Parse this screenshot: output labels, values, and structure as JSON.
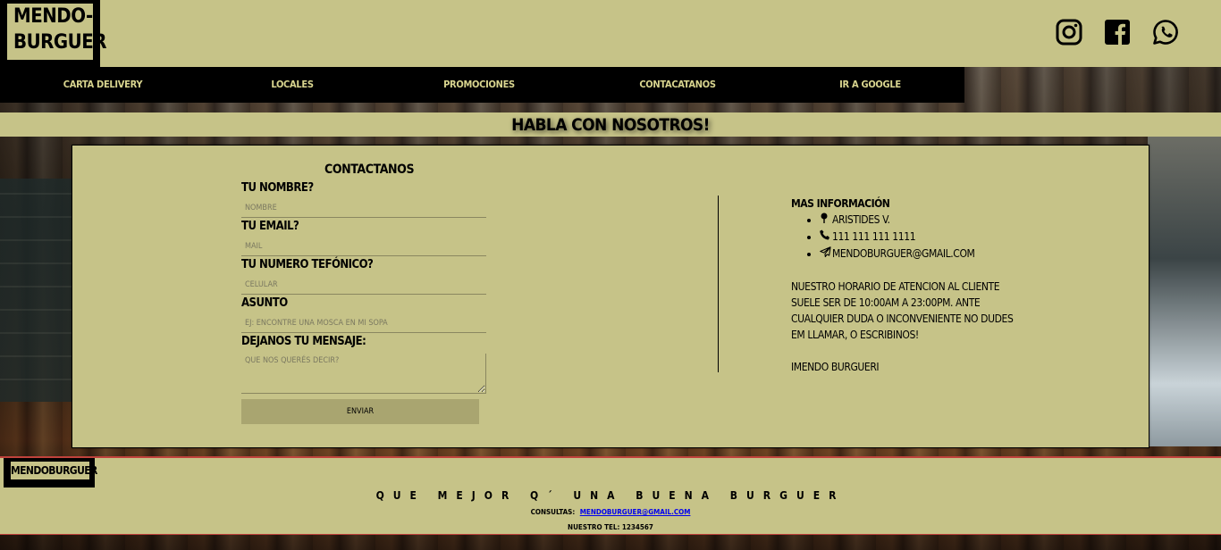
{
  "header": {
    "logo_line1": "MENDO-",
    "logo_line2": "BURGUER",
    "social": [
      {
        "icon": "instagram-icon"
      },
      {
        "icon": "facebook-icon"
      },
      {
        "icon": "whatsapp-icon"
      }
    ]
  },
  "nav": {
    "items": [
      {
        "label": "CARTA DELIVERY"
      },
      {
        "label": "LOCALES"
      },
      {
        "label": "PROMOCIONES"
      },
      {
        "label": "CONTACATANOS"
      },
      {
        "label": "IR A GOOGLE"
      }
    ]
  },
  "page_title": "HABLA CON NOSOTROS!",
  "form": {
    "title": "CONTACTANOS",
    "name_label": "TU NOMBRE?",
    "name_placeholder": "NOMBRE",
    "email_label": "TU EMAIL?",
    "email_placeholder": "MAIL",
    "phone_label": "TU NUMERO TEFÓNICO?",
    "phone_placeholder": "CELULAR",
    "subject_label": "ASUNTO",
    "subject_placeholder": "EJ: ENCONTRE UNA MOSCA EN MI SOPA",
    "message_label": "DEJANOS TU MENSAJE:",
    "message_placeholder": "QUE NOS QUERÉS DECIR?",
    "send_label": "ENVIAR"
  },
  "info": {
    "title": "MAS INFORMACIÓN",
    "address": "ARISTIDES V.",
    "phone": "111 111 111 1111",
    "email": "MENDOBURGUER@GMAIL.COM",
    "hours_text": "NUESTRO HORARIO DE ATENCION AL CLIENTE SUELE SER DE 10:00AM A 23:00PM. ANTE CUALQUIER DUDA O INCONVENIENTE NO DUDES EM LLAMAR, O ESCRIBINOS!",
    "signature": "IMENDO BURGUERI"
  },
  "footer": {
    "logo": "MENDOBURGUER",
    "slogan": "QUE MEJOR Q´ UNA BUENA BURGUER",
    "consultas_label": "CONSULTAS:",
    "consultas_email": "MENDOBURGUER@GMAIL.COM",
    "tel": "NUESTRO TEL: 1234567"
  },
  "colors": {
    "khaki": "#c6c388",
    "nav_bg": "#000000",
    "nav_text": "#d9d58f",
    "button_bg": "#a9a570",
    "footer_border": "#c0423c"
  }
}
